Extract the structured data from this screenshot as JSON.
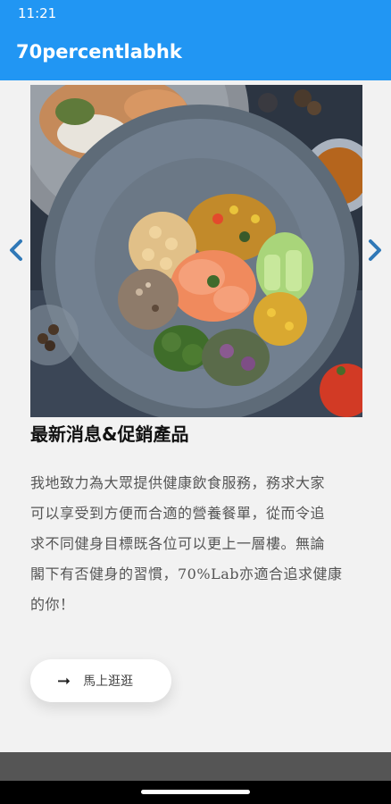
{
  "status_bar": {
    "time": "11:21"
  },
  "app_bar": {
    "title": "70percentlabhk"
  },
  "carousel": {
    "prev_icon": "chevron-left-icon",
    "next_icon": "chevron-right-icon",
    "arrow_color": "#2f78b7",
    "image": "salmon-quinoa-bowl-photo"
  },
  "content": {
    "headline": "最新消息&促銷產品",
    "body_lines": [
      "我地致力為大眾提供健康飲食服務，務求大家",
      "可以享受到方便而合適的營養餐單，從而令追",
      "求不同健身目標既各位可以更上一層樓。無論",
      "閣下有否健身的習慣，70%Lab亦適合追求健康",
      "的你！"
    ]
  },
  "shop_button": {
    "icon": "arrow-right-icon",
    "arrow": "➞",
    "label": "馬上逛逛"
  },
  "colors": {
    "app_bar": "#2196f3",
    "background": "#f2f2f2",
    "footer": "#555555"
  }
}
